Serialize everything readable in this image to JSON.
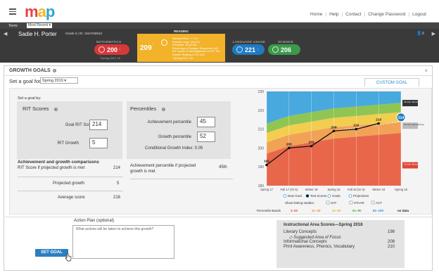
{
  "header": {
    "logo": [
      "m",
      "a",
      "p"
    ],
    "nav": [
      "Home",
      "Help",
      "Contact",
      "Change Password",
      "Logout"
    ]
  },
  "term": {
    "label": "Term:",
    "value": "Most Recent"
  },
  "student": {
    "name": "Sadie H. Porter",
    "id": "Grade 5 | ID: 1534768910"
  },
  "subjects": [
    {
      "key": "math",
      "label": "MATHEMATICS",
      "score": "200",
      "trend": "↑",
      "sub": "*Spring 2017-18",
      "color": "#d6383a"
    },
    {
      "key": "lang",
      "label": "LANGUAGE USAGE",
      "score": "221",
      "trend": "↑",
      "sub": "",
      "color": "#1f7ac2"
    },
    {
      "key": "sci",
      "label": "SCIENCE",
      "score": "206",
      "trend": "",
      "sub": "",
      "color": "#3a9a4a"
    }
  ],
  "reading": {
    "label": "READING",
    "score": "209",
    "trend": "↑",
    "details": [
      "Standard Error: +/- 3.0",
      "Possible range: 206-212",
      "Percentile: 45 (43-50)",
      "Percentage of Disagree Responses: N/A",
      "RIT: Impact of Disengagement on RIT: N/A",
      "Growth: Reading 2-5 IE 2017"
    ],
    "sub": "*Spring 2017-18"
  },
  "growth": {
    "title": "GROWTH GOALS",
    "close": "×",
    "set_goal_for": "Set a goal for:",
    "season": "Spring 2019",
    "custom_tab": "CUSTOM GOAL",
    "set_goal_by": "Set a goal by:",
    "rit_title": "RIT Scores",
    "goal_rit_label": "Goal RIT Score",
    "goal_rit_value": "214",
    "rit_growth_label": "RIT Growth",
    "rit_growth_value": "5",
    "perc_title": "Percentiles",
    "ach_label": "Achievement percentile",
    "ach_value": "45",
    "gp_label": "Growth percentile",
    "gp_value": "52",
    "cgi": "Conditional Growth Index: 0.05",
    "comparisons_title": "Achievement and growth comparisons",
    "rit_if_met_label": "RIT Score if projected growth is met",
    "rit_if_met_value": "214",
    "ach_if_met_label": "Achievement percentile if projected growth is met",
    "ach_if_met_value": "45th",
    "proj_growth_label": "Projected growth",
    "proj_growth_value": "5",
    "avg_score_label": "Average score",
    "avg_score_value": "216"
  },
  "chart_data": {
    "type": "area",
    "categories": [
      "Spring 17",
      "Fall 17 (Gr 5)",
      "Winter 18",
      "Spring 18",
      "Fall 18 (Gr 6)",
      "Winter 18",
      "Spring 19"
    ],
    "ylim": [
      180,
      230
    ],
    "yticks": [
      180,
      190,
      200,
      210,
      220,
      230
    ],
    "series": [
      {
        "name": "Test Scores",
        "values": [
          191,
          200,
          201,
          209,
          210,
          213,
          null
        ]
      },
      {
        "name": "New Goal",
        "values": [
          null,
          null,
          null,
          209,
          null,
          null,
          214
        ]
      }
    ],
    "point_labels": [
      "191",
      "200",
      "201",
      "209",
      "210",
      "213",
      "214"
    ],
    "band_bounds": [
      [
        180,
        180,
        180,
        180,
        180,
        180,
        180
      ],
      [
        197,
        201,
        203,
        205,
        206,
        207,
        208
      ],
      [
        203,
        207,
        209,
        211,
        212,
        213,
        214
      ],
      [
        208,
        212,
        214,
        216,
        217,
        218,
        219
      ],
      [
        213,
        217,
        219,
        221,
        222,
        223,
        224
      ],
      [
        230,
        230,
        230,
        230,
        230,
        230,
        230
      ]
    ],
    "band_colors": [
      "#e8674a",
      "#f2a257",
      "#f3cd50",
      "#8fc553",
      "#47a9dd"
    ],
    "right_labels": [
      "23 both: Above",
      "23 both: Approaching",
      "23 both: Below"
    ],
    "legend": [
      "New Goal",
      "Test Scores",
      "Goals",
      "Projections"
    ],
    "linking_label": "Show linking studies:",
    "linking": [
      "SAT",
      "STAAR",
      "ACT"
    ],
    "percentile_bands_label": "Percentile Bands",
    "percentile_bands": [
      {
        "label": "1–20",
        "color": "#e0463a"
      },
      {
        "label": "21–40",
        "color": "#ee8f3a"
      },
      {
        "label": "41–60",
        "color": "#e2b92a"
      },
      {
        "label": "61–80",
        "color": "#57a83a"
      },
      {
        "label": "81–100",
        "color": "#2a8fd0"
      },
      {
        "label": "no data",
        "color": "#222"
      }
    ]
  },
  "action": {
    "label": "Action Plan (optional)",
    "placeholder": "What actions will be taken to achieve this growth?",
    "button": "SET GOAL"
  },
  "instructional": {
    "title": "Instructional Area Scores—Spring 2018",
    "rows": [
      {
        "label": "Literary Concepts",
        "value": "198"
      },
      {
        "label": "◇ Suggested Area of Focus",
        "value": ""
      },
      {
        "label": "Informational Concepts",
        "value": "208"
      },
      {
        "label": "Print Awareness, Phonics, Vocabulary",
        "value": "210"
      }
    ]
  }
}
